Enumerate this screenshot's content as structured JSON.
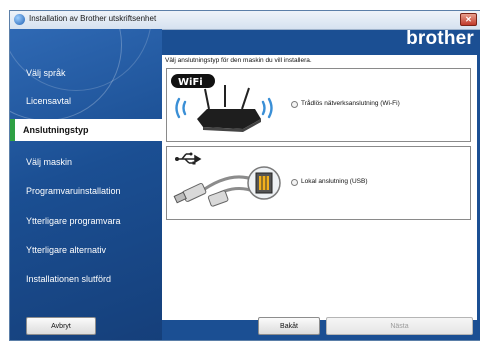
{
  "window": {
    "title": "Installation av Brother utskriftsenhet",
    "brand": "brother"
  },
  "sidebar": {
    "items": [
      {
        "label": "Välj språk"
      },
      {
        "label": "Licensavtal"
      },
      {
        "label": "Anslutningstyp",
        "active": true
      },
      {
        "label": "Välj maskin"
      },
      {
        "label": "Programvaruinstallation"
      },
      {
        "label": "Ytterligare programvara"
      },
      {
        "label": "Ytterligare alternativ"
      },
      {
        "label": "Installationen slutförd"
      }
    ]
  },
  "main": {
    "instruction": "Välj anslutningstyp för den maskin du vill installera.",
    "options": [
      {
        "label": "Trådlös nätverksanslutning (Wi-Fi)",
        "badge": "WiFi",
        "icon": "wireless-router-icon",
        "selected": false
      },
      {
        "label": "Lokal anslutning (USB)",
        "icon": "usb-cable-icon",
        "selected": false
      }
    ]
  },
  "buttons": {
    "cancel": "Avbryt",
    "back": "Bakåt",
    "next": "Nästa"
  },
  "colors": {
    "accent": "#1b4f93",
    "active_marker": "#2ea043"
  }
}
